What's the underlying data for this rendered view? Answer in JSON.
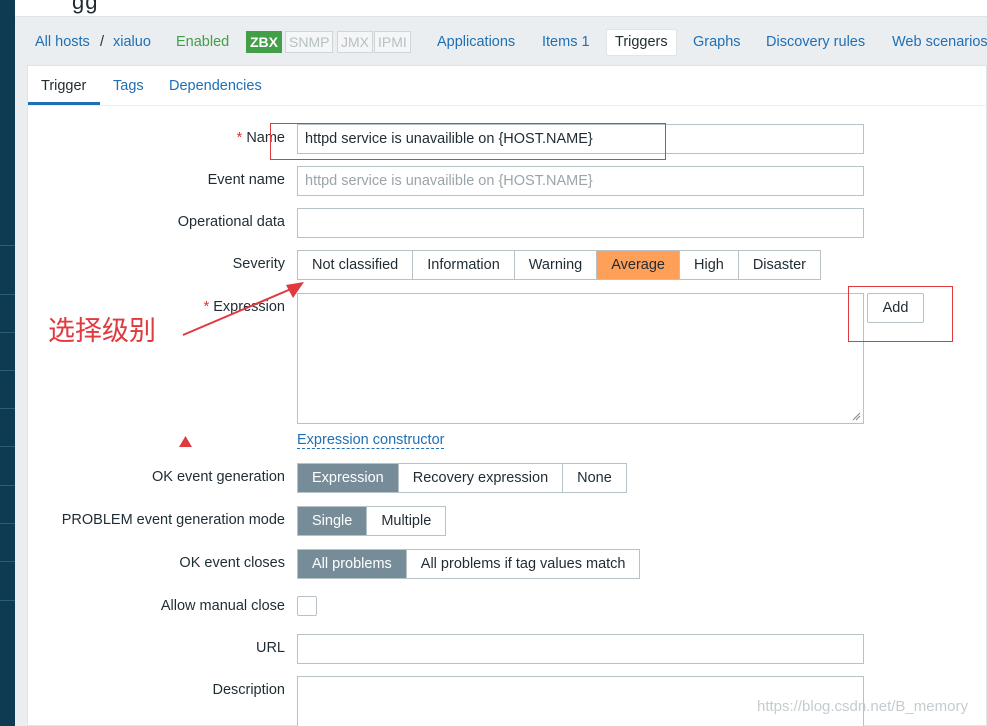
{
  "header": {
    "title_fragment": "gg"
  },
  "hostnav": {
    "all_hosts": "All hosts",
    "separator": "/",
    "host": "xialuo",
    "status": "Enabled",
    "availability": [
      "ZBX",
      "SNMP",
      "JMX",
      "IPMI"
    ],
    "links": [
      "Applications",
      "Items 1",
      "Triggers",
      "Graphs",
      "Discovery rules",
      "Web scenarios"
    ],
    "active_link": "Triggers"
  },
  "subtabs": [
    "Trigger",
    "Tags",
    "Dependencies"
  ],
  "form": {
    "name_label": "Name",
    "name_value": "httpd service is  unavailible on {HOST.NAME}",
    "event_name_label": "Event name",
    "event_name_placeholder": "httpd service is  unavailible on {HOST.NAME}",
    "operational_data_label": "Operational data",
    "operational_data_value": "",
    "severity_label": "Severity",
    "severity_options": [
      "Not classified",
      "Information",
      "Warning",
      "Average",
      "High",
      "Disaster"
    ],
    "severity_selected": "Average",
    "expression_label": "Expression",
    "expression_value": "",
    "add_button": "Add",
    "expression_constructor": "Expression constructor",
    "ok_event_generation_label": "OK event generation",
    "ok_event_generation_options": [
      "Expression",
      "Recovery expression",
      "None"
    ],
    "ok_event_generation_selected": "Expression",
    "problem_mode_label": "PROBLEM event generation mode",
    "problem_mode_options": [
      "Single",
      "Multiple"
    ],
    "problem_mode_selected": "Single",
    "ok_event_closes_label": "OK event closes",
    "ok_event_closes_options": [
      "All problems",
      "All problems if tag values match"
    ],
    "ok_event_closes_selected": "All problems",
    "allow_manual_close_label": "Allow manual close",
    "allow_manual_close_checked": false,
    "url_label": "URL",
    "url_value": "",
    "description_label": "Description",
    "description_value": ""
  },
  "annotation": {
    "text": "选择级别",
    "color": "#e0393e"
  },
  "watermark": "https://blog.csdn.net/B_memory",
  "colors": {
    "link": "#1f6fb4",
    "enabled": "#429e47",
    "selected_segment": "#768d99",
    "average_severity": "#ffa059",
    "required": "#e03232"
  }
}
